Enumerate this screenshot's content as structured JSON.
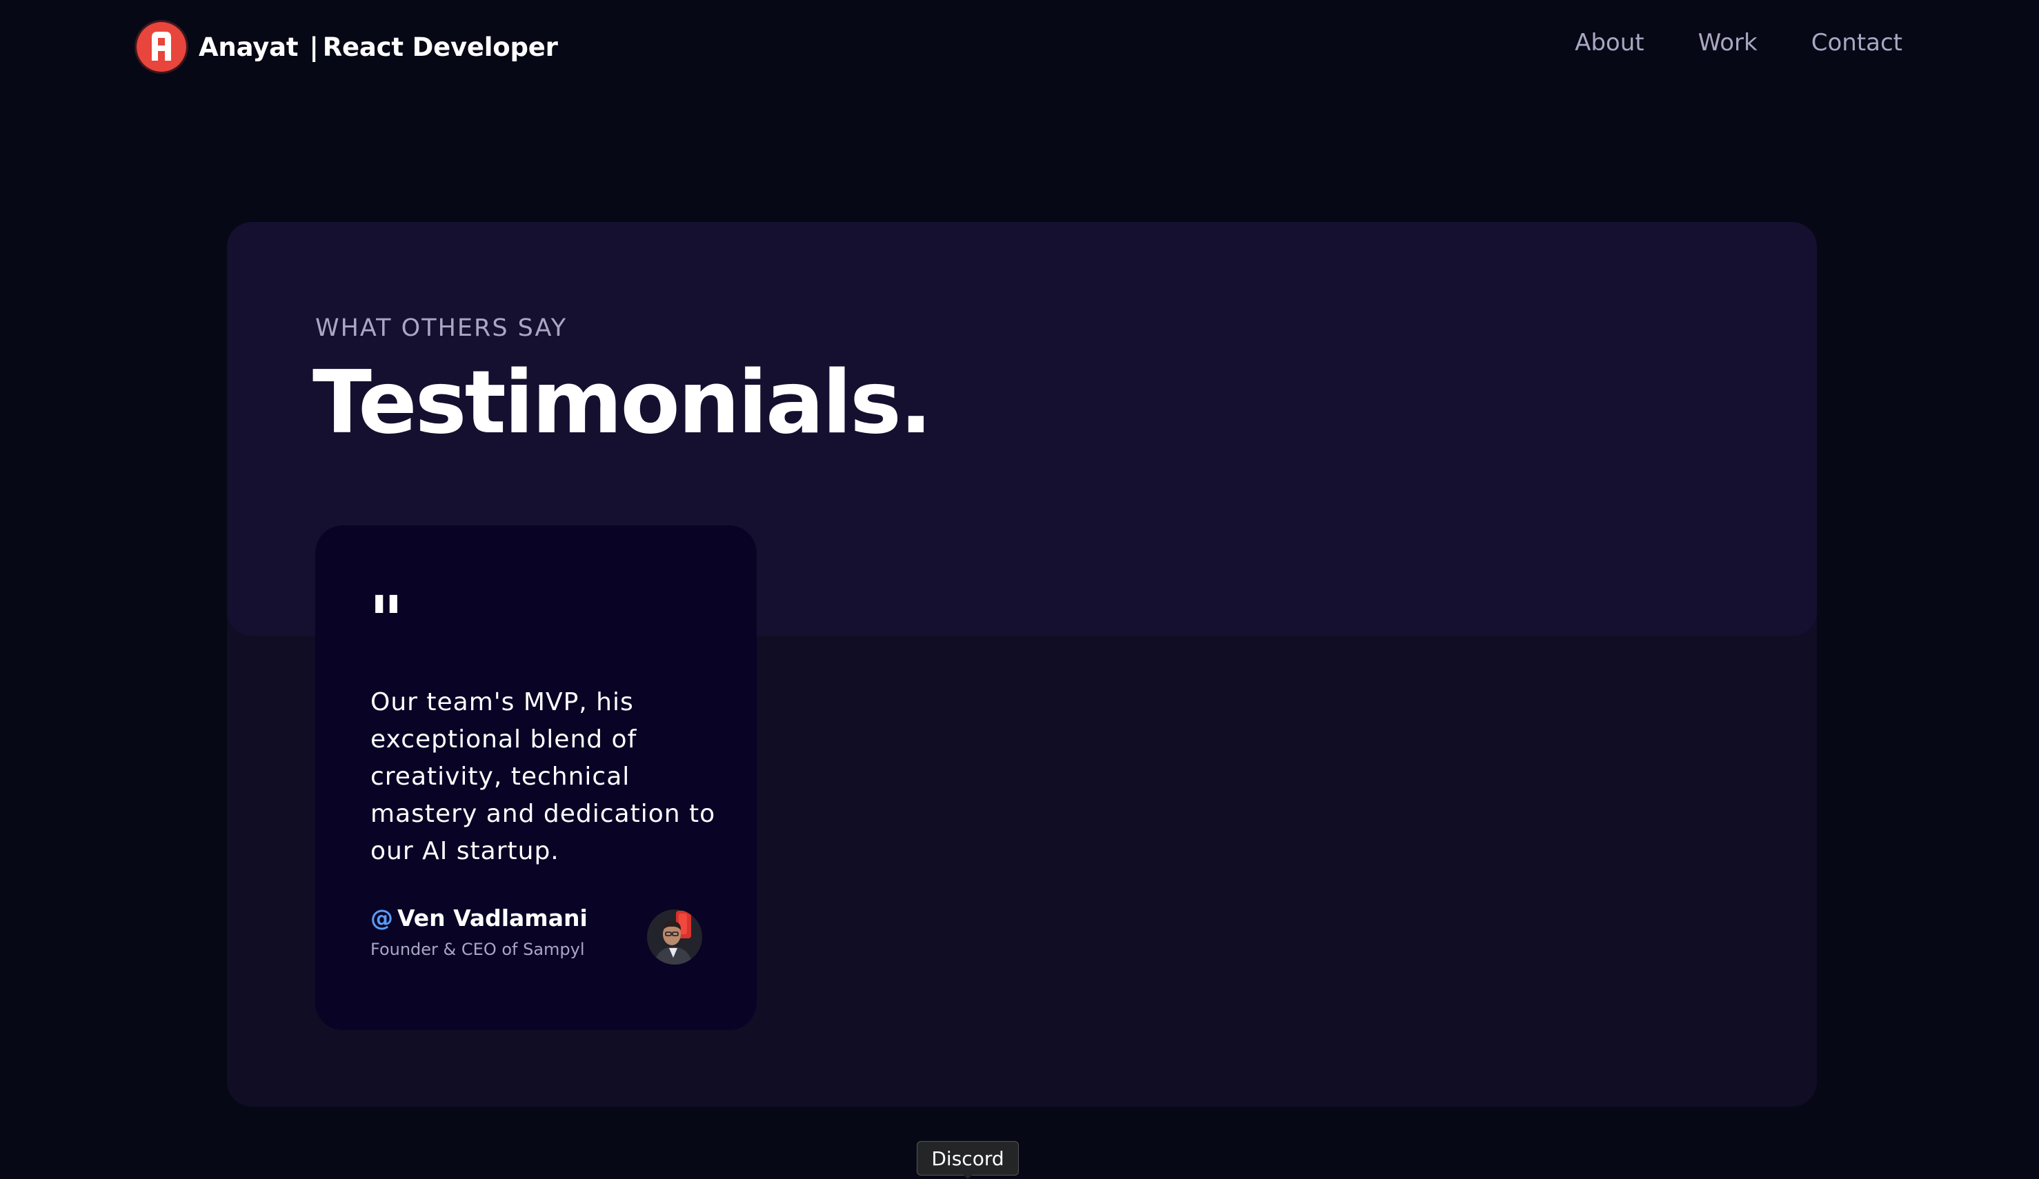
{
  "navbar": {
    "brand_name": "Anayat",
    "brand_separator": "|",
    "brand_role": "React Developer",
    "logo_icon": "letter-a-logo-icon",
    "links": [
      {
        "label": "About"
      },
      {
        "label": "Work"
      },
      {
        "label": "Contact"
      }
    ]
  },
  "testimonials": {
    "subtitle": "WHAT OTHERS SAY",
    "title": "Testimonials.",
    "cards": [
      {
        "quote_mark": "\"",
        "quote": "Our team's MVP, his exceptional blend of creativity, technical mastery and dedication to our AI startup.",
        "at_sign": "@",
        "name": "Ven Vadlamani",
        "role": "Founder & CEO of Sampyl",
        "avatar_icon": "avatar-photo"
      }
    ]
  },
  "tooltip": {
    "label": "Discord"
  },
  "colors": {
    "background": "#060815",
    "panel": "#100d25",
    "panel_header": "#151030",
    "card": "#090325",
    "secondary_text": "#aaa6c3",
    "logo_red": "#e8453c",
    "at_sign_blue": "#5a9cf5"
  }
}
